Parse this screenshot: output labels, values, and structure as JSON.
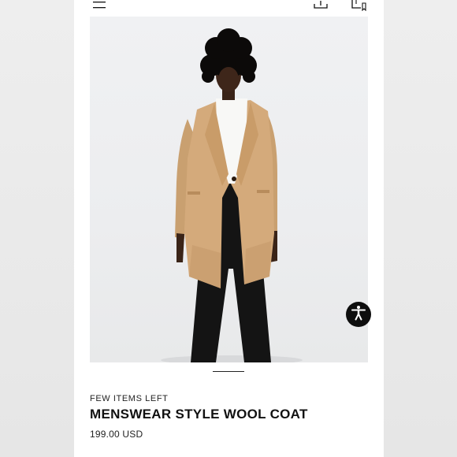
{
  "header": {
    "menu_icon": "hamburger-menu-icon",
    "share_icon": "share-icon",
    "bag_icon": "shopping-bag-icon"
  },
  "product": {
    "image_alt": "Model wearing camel menswear style wool coat",
    "stock_note": "FEW ITEMS LEFT",
    "name": "MENSWEAR STYLE WOOL COAT",
    "price": "199.00 USD"
  },
  "accessibility": {
    "icon": "accessibility-icon"
  },
  "colors": {
    "coat": "#d4aa7b",
    "accessibility_button": "#0e0e0e",
    "background": "#ffffff"
  }
}
